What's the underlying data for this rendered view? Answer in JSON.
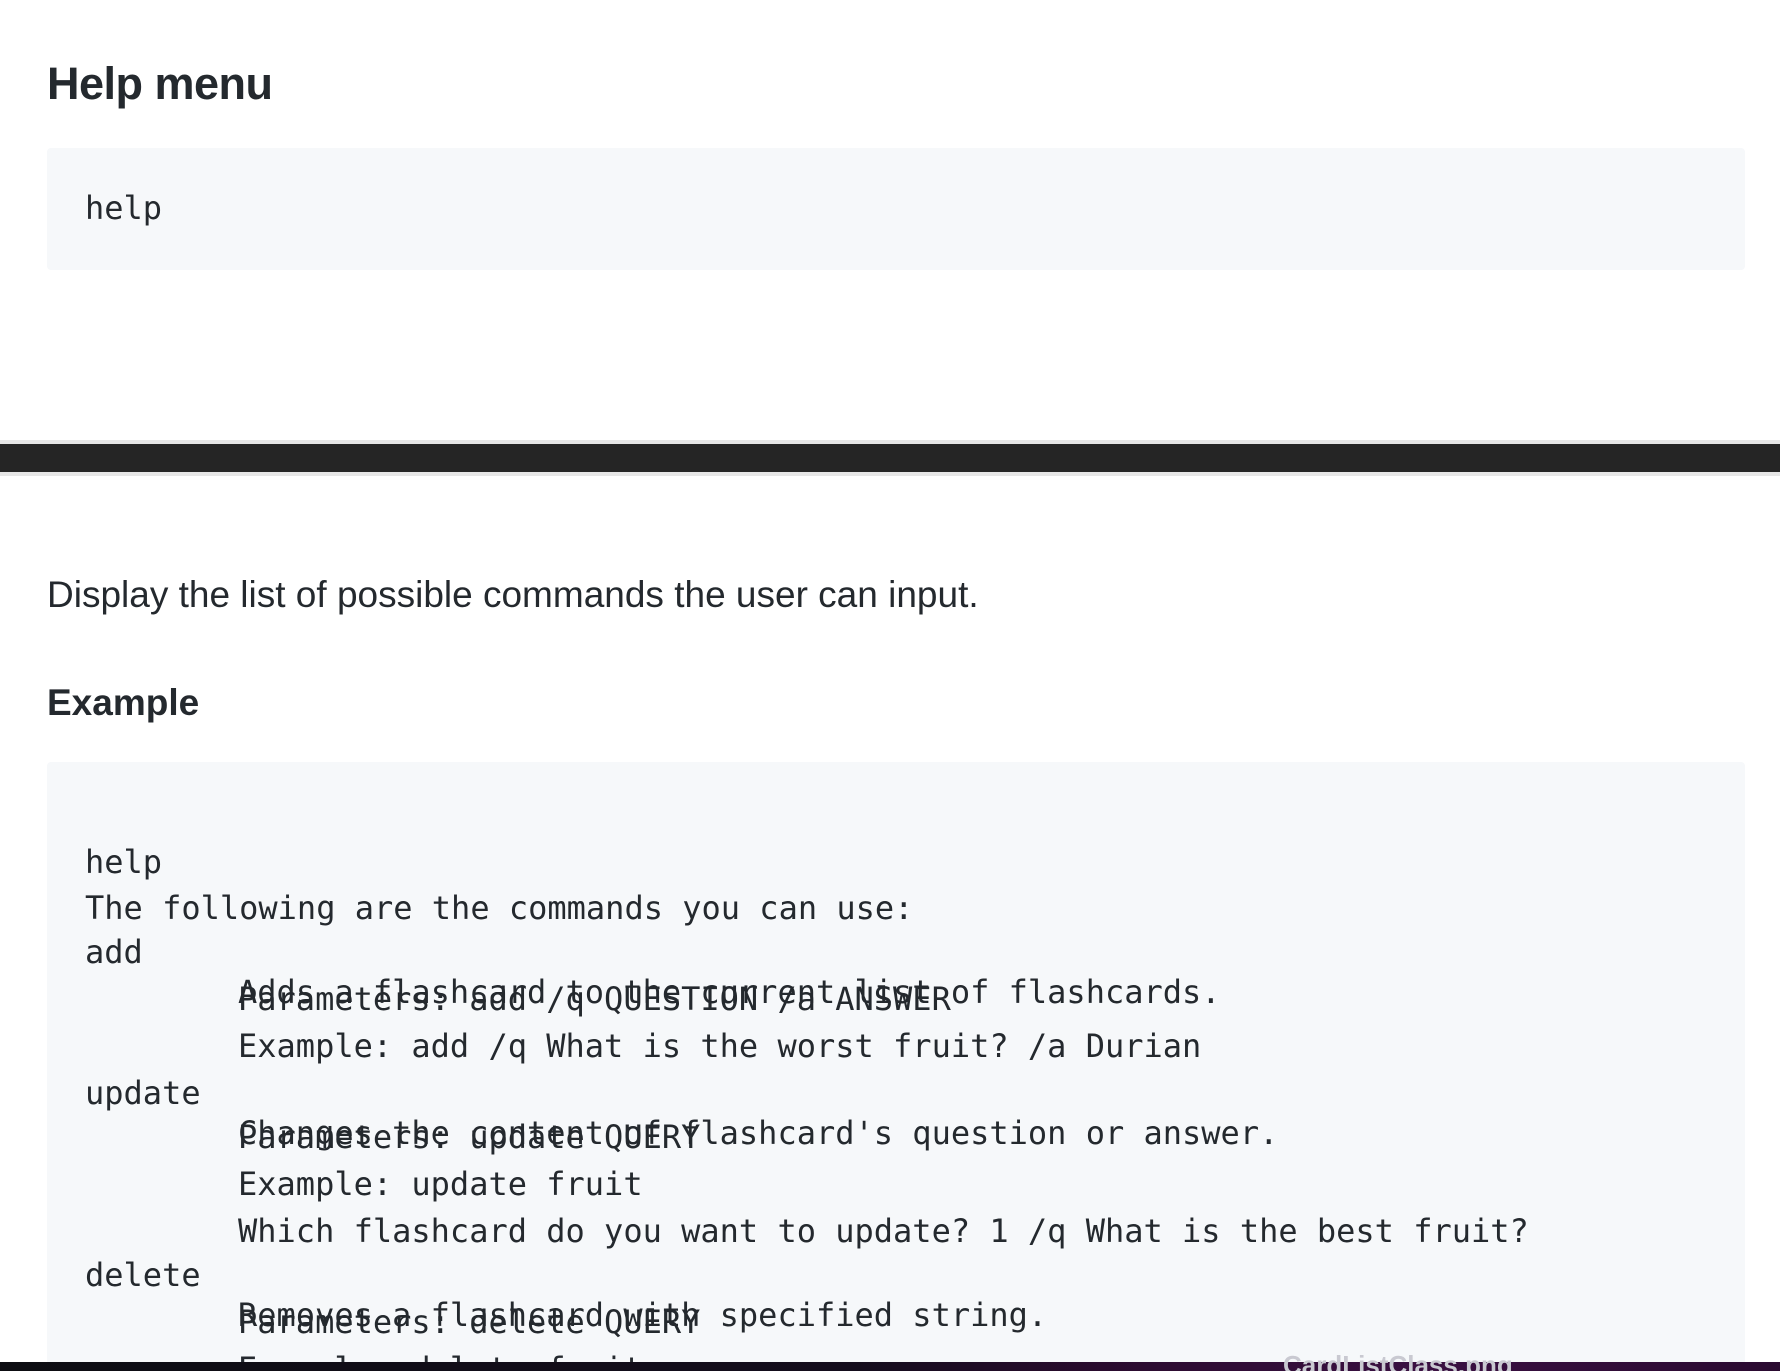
{
  "section": {
    "heading": "Help menu",
    "usage_code": "help"
  },
  "description": "Display the list of possible commands the user can input.",
  "example": {
    "heading": "Example",
    "lines": [
      {
        "cmd": "help",
        "text": ""
      },
      {
        "cmd": "The following are the commands you can use:",
        "text": ""
      },
      {
        "cmd": "add",
        "text": "Adds a flashcard to the current list of flashcards."
      },
      {
        "cmd": "",
        "text": "Parameters: add /q QUESTION /a ANSWER"
      },
      {
        "cmd": "",
        "text": "Example: add /q What is the worst fruit? /a Durian"
      },
      {
        "cmd": "update",
        "text": "Changes the content of flashcard's question or answer."
      },
      {
        "cmd": "",
        "text": "Parameters: update QUERY"
      },
      {
        "cmd": "",
        "text": "Example: update fruit"
      },
      {
        "cmd": "",
        "text": "Which flashcard do you want to update? 1 /q What is the best fruit?"
      },
      {
        "cmd": "delete",
        "text": "Removes a flashcard with specified string."
      },
      {
        "cmd": "",
        "text": "Parameters: delete QUERY"
      },
      {
        "cmd": "",
        "text": "Example: delete fruit"
      }
    ]
  },
  "taskbar": {
    "filename": "CardListClass.png"
  }
}
